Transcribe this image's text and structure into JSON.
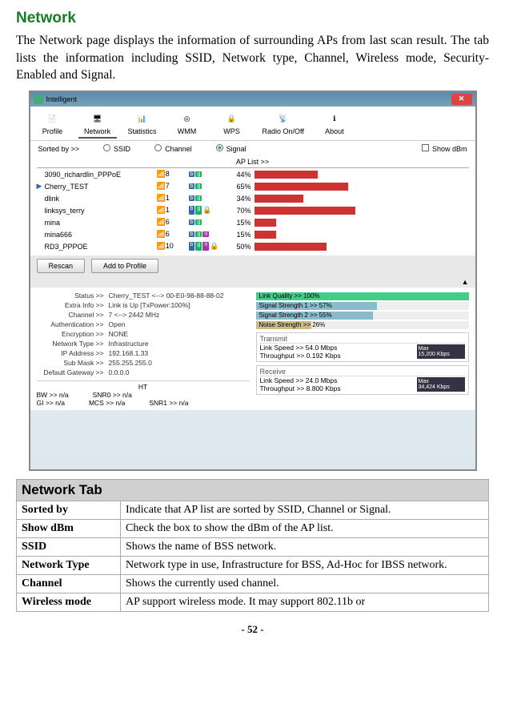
{
  "heading": "Network",
  "paragraph": "The Network page displays the information of surrounding APs from last scan result. The tab lists the information including SSID, Network type, Channel, Wireless mode, Security-Enabled and Signal.",
  "app": {
    "title": "Intelligent",
    "tabs": [
      "Profile",
      "Network",
      "Statistics",
      "WMM",
      "WPS",
      "Radio On/Off",
      "About"
    ],
    "sort_label": "Sorted by >>",
    "sort_options": [
      "SSID",
      "Channel",
      "Signal"
    ],
    "show_dbm": "Show dBm",
    "ap_list_label": "AP List >>",
    "aps": [
      {
        "ssid": "3090_richardlin_PPPoE",
        "ch": "8",
        "modes": [
          "b",
          "g"
        ],
        "signal": "44%"
      },
      {
        "ssid": "Cherry_TEST",
        "ch": "7",
        "modes": [
          "b",
          "g"
        ],
        "signal": "65%",
        "selected": true
      },
      {
        "ssid": "dlink",
        "ch": "1",
        "modes": [
          "b",
          "g"
        ],
        "signal": "34%"
      },
      {
        "ssid": "linksys_terry",
        "ch": "1",
        "modes": [
          "b",
          "g"
        ],
        "signal": "70%",
        "lock": true
      },
      {
        "ssid": "mina",
        "ch": "6",
        "modes": [
          "b",
          "g"
        ],
        "signal": "15%"
      },
      {
        "ssid": "mina666",
        "ch": "6",
        "modes": [
          "b",
          "g",
          "n"
        ],
        "signal": "15%"
      },
      {
        "ssid": "RD3_PPPOE",
        "ch": "10",
        "modes": [
          "b",
          "g",
          "n"
        ],
        "signal": "50%",
        "lock": true
      }
    ],
    "buttons": {
      "rescan": "Rescan",
      "add": "Add to Profile"
    },
    "details_left": [
      {
        "label": "Status >>",
        "val": "Cherry_TEST <--> 00-E0-98-88-88-02"
      },
      {
        "label": "Extra Info >>",
        "val": "Link is Up [TxPower:100%]"
      },
      {
        "label": "Channel >>",
        "val": "7 <--> 2442 MHz"
      },
      {
        "label": "Authentication >>",
        "val": "Open"
      },
      {
        "label": "Encryption >>",
        "val": "NONE"
      },
      {
        "label": "Network Type >>",
        "val": "Infrastructure"
      },
      {
        "label": "IP Address >>",
        "val": "192.168.1.33"
      },
      {
        "label": "Sub Mask >>",
        "val": "255.255.255.0"
      },
      {
        "label": "Default Gateway >>",
        "val": "0.0.0.0"
      }
    ],
    "quality": [
      {
        "label": "Link Quality >> 100%",
        "pct": 100,
        "color": "#4c8"
      },
      {
        "label": "Signal Strength 1 >> 57%",
        "pct": 57,
        "color": "#8bc"
      },
      {
        "label": "Signal Strength 2 >> 55%",
        "pct": 55,
        "color": "#8bc"
      },
      {
        "label": "Noise Strength >> 26%",
        "pct": 26,
        "color": "#cb8"
      }
    ],
    "transmit": {
      "title": "Transmit",
      "speed": "Link Speed >>  54.0 Mbps",
      "throughput": "Throughput >> 0.192 Kbps",
      "max": "Max",
      "val": "15,200 Kbps"
    },
    "receive": {
      "title": "Receive",
      "speed": "Link Speed >> 24.0 Mbps",
      "throughput": "Throughput >> 8.800 Kbps",
      "max": "Max",
      "val": "34,424 Kbps"
    },
    "ht": {
      "header": "HT",
      "bw": "BW >> n/a",
      "gi": "GI >> n/a",
      "mcs": "MCS >>   n/a",
      "snr0": "SNR0 >>   n/a",
      "snr1": "SNR1 >>   n/a"
    }
  },
  "table": {
    "section": "Network Tab",
    "rows": [
      {
        "label": "Sorted by",
        "desc": "Indicate that AP list are sorted by SSID, Channel or Signal."
      },
      {
        "label": "Show dBm",
        "desc": "Check the box to show the dBm of the AP list."
      },
      {
        "label": "SSID",
        "desc": "Shows the name of BSS network."
      },
      {
        "label": "Network Type",
        "desc": "Network type in use, Infrastructure for BSS, Ad-Hoc for IBSS network."
      },
      {
        "label": "Channel",
        "desc": "Shows the currently used channel."
      },
      {
        "label": "Wireless mode",
        "desc": "AP support wireless mode. It may support 802.11b or"
      }
    ]
  },
  "page_num": "- 52 -"
}
